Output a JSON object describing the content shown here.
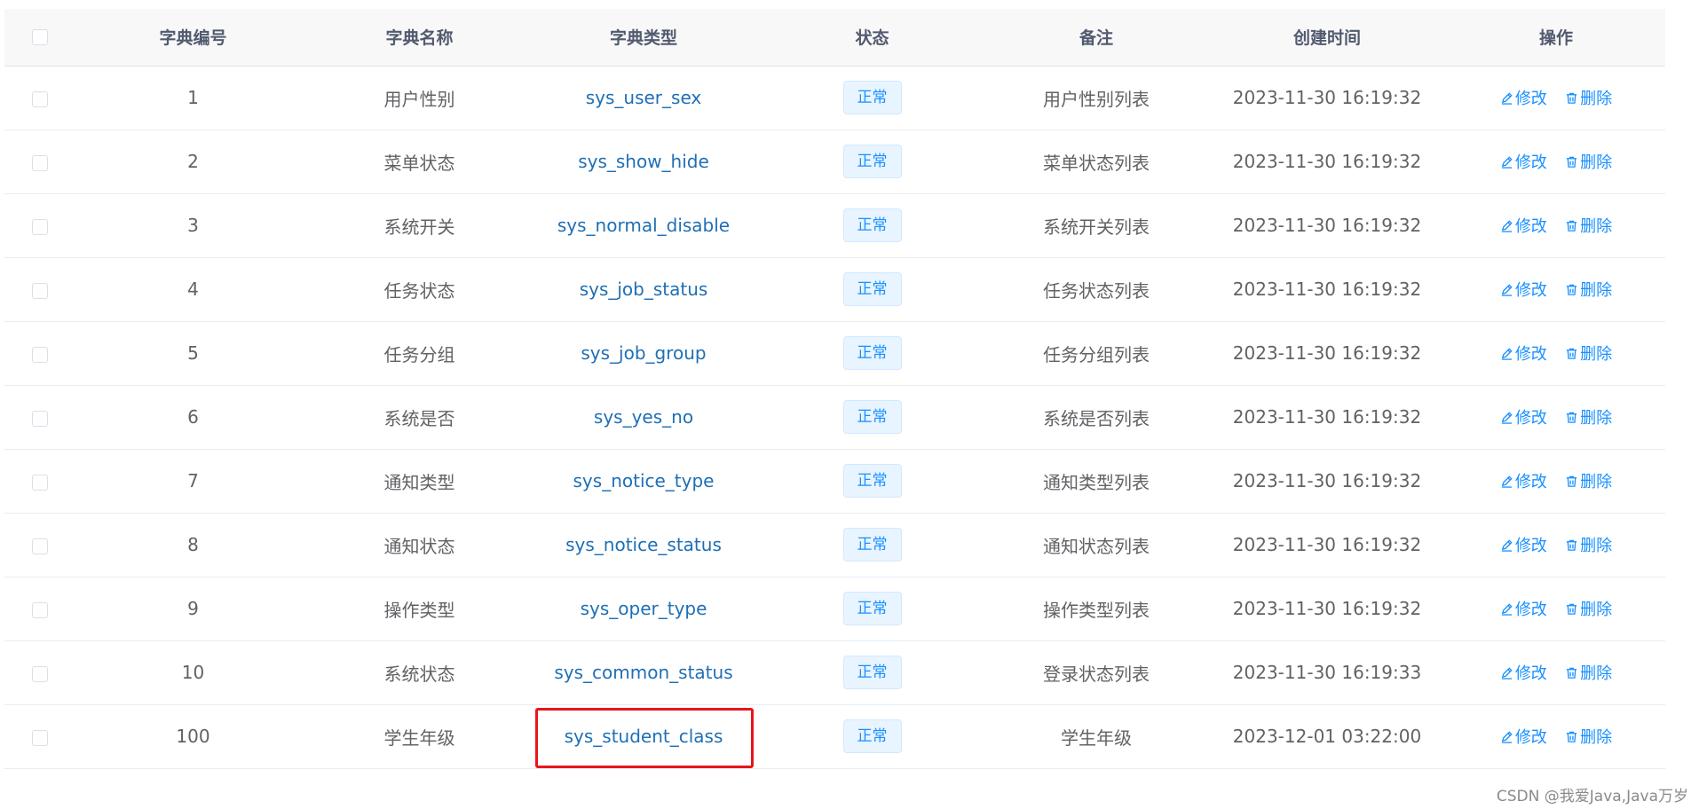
{
  "table": {
    "headers": {
      "id": "字典编号",
      "name": "字典名称",
      "type": "字典类型",
      "status": "状态",
      "remark": "备注",
      "created": "创建时间",
      "actions": "操作"
    },
    "edit_label": "修改",
    "delete_label": "删除",
    "rows": [
      {
        "id": "1",
        "name": "用户性别",
        "type": "sys_user_sex",
        "status": "正常",
        "remark": "用户性别列表",
        "created": "2023-11-30 16:19:32"
      },
      {
        "id": "2",
        "name": "菜单状态",
        "type": "sys_show_hide",
        "status": "正常",
        "remark": "菜单状态列表",
        "created": "2023-11-30 16:19:32"
      },
      {
        "id": "3",
        "name": "系统开关",
        "type": "sys_normal_disable",
        "status": "正常",
        "remark": "系统开关列表",
        "created": "2023-11-30 16:19:32"
      },
      {
        "id": "4",
        "name": "任务状态",
        "type": "sys_job_status",
        "status": "正常",
        "remark": "任务状态列表",
        "created": "2023-11-30 16:19:32"
      },
      {
        "id": "5",
        "name": "任务分组",
        "type": "sys_job_group",
        "status": "正常",
        "remark": "任务分组列表",
        "created": "2023-11-30 16:19:32"
      },
      {
        "id": "6",
        "name": "系统是否",
        "type": "sys_yes_no",
        "status": "正常",
        "remark": "系统是否列表",
        "created": "2023-11-30 16:19:32"
      },
      {
        "id": "7",
        "name": "通知类型",
        "type": "sys_notice_type",
        "status": "正常",
        "remark": "通知类型列表",
        "created": "2023-11-30 16:19:32"
      },
      {
        "id": "8",
        "name": "通知状态",
        "type": "sys_notice_status",
        "status": "正常",
        "remark": "通知状态列表",
        "created": "2023-11-30 16:19:32"
      },
      {
        "id": "9",
        "name": "操作类型",
        "type": "sys_oper_type",
        "status": "正常",
        "remark": "操作类型列表",
        "created": "2023-11-30 16:19:32"
      },
      {
        "id": "10",
        "name": "系统状态",
        "type": "sys_common_status",
        "status": "正常",
        "remark": "登录状态列表",
        "created": "2023-11-30 16:19:33"
      },
      {
        "id": "100",
        "name": "学生年级",
        "type": "sys_student_class",
        "status": "正常",
        "remark": "学生年级",
        "created": "2023-12-01 03:22:00",
        "highlighted": true
      }
    ]
  },
  "watermark": "CSDN @我爱Java,Java万岁",
  "colors": {
    "link": "#1f6fb5",
    "action": "#1890ff",
    "tag_bg": "#e8f4ff",
    "highlight": "#e8151b"
  },
  "icons": {
    "edit": "edit-icon",
    "delete": "delete-icon"
  }
}
